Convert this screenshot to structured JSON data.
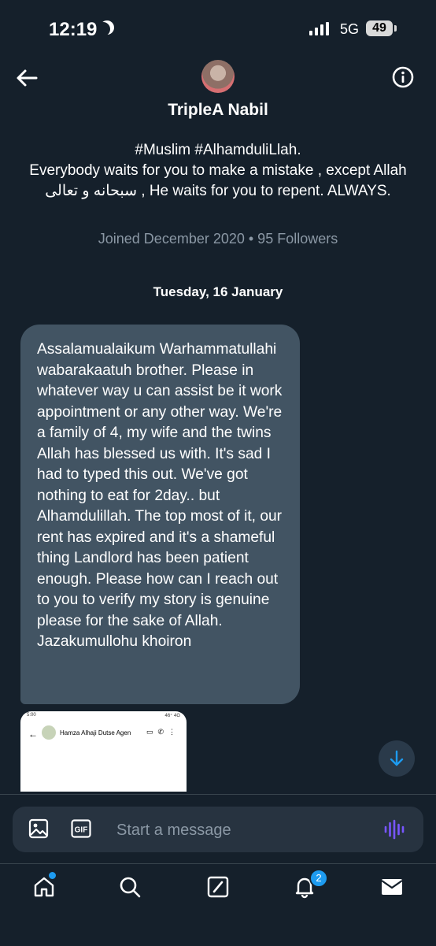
{
  "status_bar": {
    "time": "12:19",
    "network": "5G",
    "battery": "49"
  },
  "profile": {
    "name": "TripleA Nabil",
    "bio": "#Muslim #AlhamduliLlah.\nEverybody waits for you to make a mistake , except Allah سبحانه و تعالى , He waits for you to repent. ALWAYS.",
    "joined_followers": "Joined December 2020 • 95 Followers"
  },
  "conversation": {
    "date_label": "Tuesday, 16 January",
    "message": "Assalamualaikum Warhammatullahi wabarakaatuh brother. Please in whatever way u can assist be it work appointment or any other way. We're a family of 4, my wife and the twins Allah has blessed us with. It's sad I had to typed this out. We've got nothing to eat for 2day.. but Alhamdulillah. The top most of it, our rent has expired and it's a shameful thing Landlord has been patient enough. Please how can I reach out to you to verify my story is genuine please for the sake of Allah. Jazakumullohu khoiron",
    "attachment": {
      "status_time": "5:00",
      "status_right": "46⁺ 4G",
      "contact_name": "Hamza Alhaji Dutse Agen"
    }
  },
  "composer": {
    "placeholder": "Start a message",
    "gif_label": "GIF"
  },
  "bottom_nav": {
    "notifications_count": "2"
  },
  "colors": {
    "background": "#15202b",
    "bubble": "#425463",
    "accent": "#1d9bf0",
    "voice": "#7856ff"
  },
  "icons": [
    "arrow-left-icon",
    "info-icon",
    "image-icon",
    "gif-icon",
    "voice-wave-icon",
    "home-icon",
    "search-icon",
    "grok-icon",
    "bell-icon",
    "mail-icon",
    "arrow-down-icon"
  ]
}
